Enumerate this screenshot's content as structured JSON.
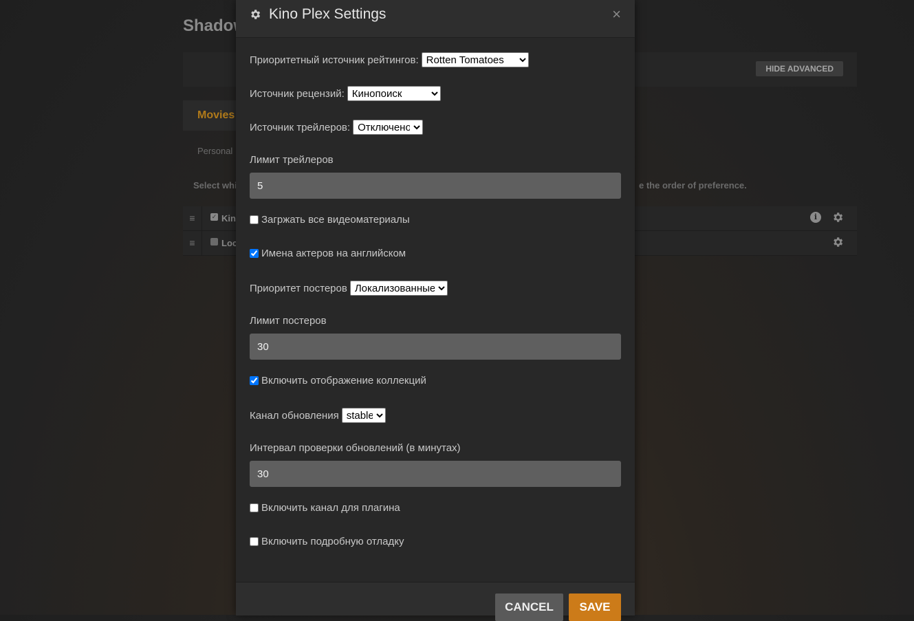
{
  "background": {
    "title": "Shadow",
    "hide_advanced": "HIDE ADVANCED",
    "tab_movies": "Movies",
    "tab_personal": "Personal",
    "select_text": "Select whi",
    "order_text": "e the order of preference.",
    "agents": [
      {
        "name": "Kin",
        "checked": true
      },
      {
        "name": "Loc",
        "checked": false
      }
    ]
  },
  "dialog": {
    "title": "Kino Plex Settings",
    "close": "×",
    "ratings_source": {
      "label": "Приоритетный источник рейтингов:",
      "value": "Rotten Tomatoes"
    },
    "reviews_source": {
      "label": "Источник рецензий:",
      "value": "Кинопоиск"
    },
    "trailers_source": {
      "label": "Источник трейлеров:",
      "value": "Отключено"
    },
    "trailers_limit": {
      "label": "Лимит трейлеров",
      "value": "5"
    },
    "load_all_media": {
      "label": "Загржать все видеоматериалы",
      "checked": false
    },
    "actors_english": {
      "label": "Имена актеров на английском",
      "checked": true
    },
    "poster_priority": {
      "label": "Приоритет постеров",
      "value": "Локализованные"
    },
    "posters_limit": {
      "label": "Лимит постеров",
      "value": "30"
    },
    "collections": {
      "label": "Включить отображение коллекций",
      "checked": true
    },
    "update_channel": {
      "label": "Канал обновления",
      "value": "stable"
    },
    "update_interval": {
      "label": "Интервал проверки обновлений (в минутах)",
      "value": "30"
    },
    "plugin_channel": {
      "label": "Включить канал для плагина",
      "checked": false
    },
    "verbose_debug": {
      "label": "Включить подробную отладку",
      "checked": false
    },
    "cancel": "CANCEL",
    "save": "SAVE"
  }
}
